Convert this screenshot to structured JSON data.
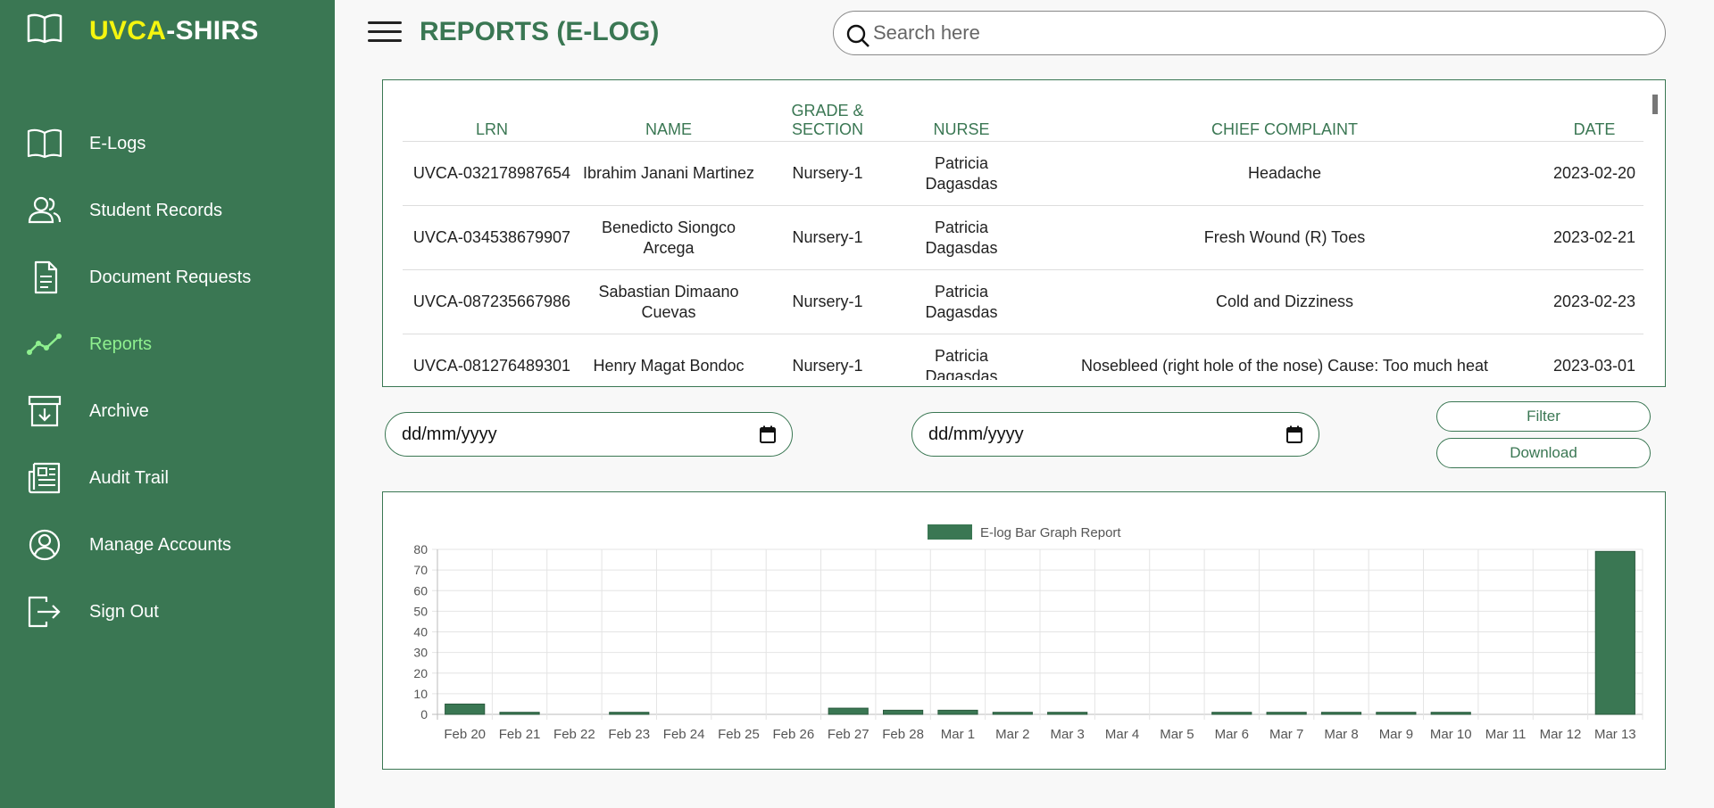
{
  "brand": {
    "highlight": "UVCA",
    "rest": "-SHIRS"
  },
  "sidebar": {
    "items": [
      {
        "label": "E-Logs",
        "icon": "book-icon"
      },
      {
        "label": "Student Records",
        "icon": "users-icon"
      },
      {
        "label": "Document Requests",
        "icon": "document-icon"
      },
      {
        "label": "Reports",
        "icon": "line-chart-icon",
        "active": true
      },
      {
        "label": "Archive",
        "icon": "archive-icon"
      },
      {
        "label": "Audit Trail",
        "icon": "newspaper-icon"
      },
      {
        "label": "Manage Accounts",
        "icon": "user-circle-icon"
      },
      {
        "label": "Sign Out",
        "icon": "sign-out-icon"
      }
    ]
  },
  "header": {
    "title": "REPORTS (E-LOG)",
    "search_placeholder": "Search here"
  },
  "table": {
    "columns": [
      "LRN",
      "NAME",
      "GRADE & SECTION",
      "NURSE",
      "CHIEF COMPLAINT",
      "DATE"
    ],
    "rows": [
      [
        "UVCA-032178987654",
        "Ibrahim Janani Martinez",
        "Nursery-1",
        "Patricia Dagasdas",
        "Headache",
        "2023-02-20"
      ],
      [
        "UVCA-034538679907",
        "Benedicto Siongco Arcega",
        "Nursery-1",
        "Patricia Dagasdas",
        "Fresh Wound (R) Toes",
        "2023-02-21"
      ],
      [
        "UVCA-087235667986",
        "Sabastian Dimaano Cuevas",
        "Nursery-1",
        "Patricia Dagasdas",
        "Cold and Dizziness",
        "2023-02-23"
      ],
      [
        "UVCA-081276489301",
        "Henry Magat Bondoc",
        "Nursery-1",
        "Patricia Dagasdas",
        "Nosebleed (right hole of the nose) Cause: Too much heat",
        "2023-03-01"
      ]
    ]
  },
  "filters": {
    "start_date_placeholder": "dd/mm/yyyy",
    "end_date_placeholder": "dd/mm/yyyy",
    "filter_label": "Filter",
    "download_label": "Download"
  },
  "colors": {
    "sidebar": "#3a7753",
    "accent": "#3a7753",
    "brand_highlight": "#f5f50f",
    "active_nav": "#8ff08f",
    "bar": "#3a7753"
  },
  "chart_data": {
    "type": "bar",
    "title": "",
    "legend": [
      "E-log Bar Graph Report"
    ],
    "legend_position": "top-center",
    "xlabel": "",
    "ylabel": "",
    "ylim": [
      0,
      80
    ],
    "yticks": [
      0,
      10,
      20,
      30,
      40,
      50,
      60,
      70,
      80
    ],
    "grid": true,
    "categories": [
      "Feb 20",
      "Feb 21",
      "Feb 22",
      "Feb 23",
      "Feb 24",
      "Feb 25",
      "Feb 26",
      "Feb 27",
      "Feb 28",
      "Mar 1",
      "Mar 2",
      "Mar 3",
      "Mar 4",
      "Mar 5",
      "Mar 6",
      "Mar 7",
      "Mar 8",
      "Mar 9",
      "Mar 10",
      "Mar 11",
      "Mar 12",
      "Mar 13"
    ],
    "series": [
      {
        "name": "E-log Bar Graph Report",
        "values": [
          5,
          1,
          0,
          1,
          0,
          0,
          0,
          3,
          2,
          2,
          1,
          1,
          0,
          0,
          1,
          1,
          1,
          1,
          1,
          0,
          0,
          79
        ]
      }
    ]
  }
}
